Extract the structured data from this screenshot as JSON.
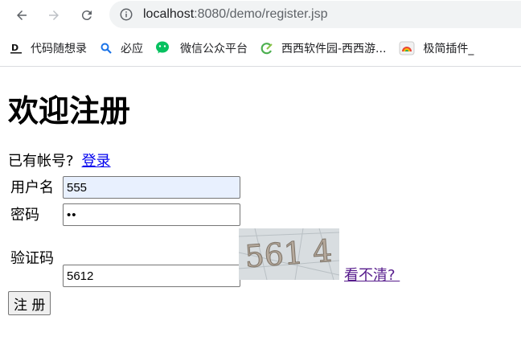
{
  "browser": {
    "url_host": "localhost",
    "url_rest": ":8080/demo/register.jsp",
    "bookmarks": [
      {
        "label": "代码随想录",
        "icon": "daimasuixianglu-icon"
      },
      {
        "label": "必应",
        "icon": "bing-search-icon"
      },
      {
        "label": "微信公众平台",
        "icon": "wechat-icon"
      },
      {
        "label": "西西软件园-西西游...",
        "icon": "xixi-icon"
      },
      {
        "label": "极简插件_",
        "icon": "jijian-plugin-icon"
      }
    ]
  },
  "page": {
    "title": "欢迎注册",
    "have_account": "已有帐号?",
    "login_link": "登录",
    "fields": {
      "username_label": "用户名",
      "username_value": "555",
      "password_label": "密码",
      "password_value": "••",
      "captcha_label": "验证码",
      "captcha_value": "5612",
      "captcha_image_text": "561 4",
      "unclear_link": "看不清? "
    },
    "submit_label": "注 册"
  },
  "colors": {
    "link": "#0000ee",
    "visited_link": "#551a8b",
    "autofill_bg": "#e8f0fe",
    "omnibox_bg": "#f1f3f4"
  }
}
